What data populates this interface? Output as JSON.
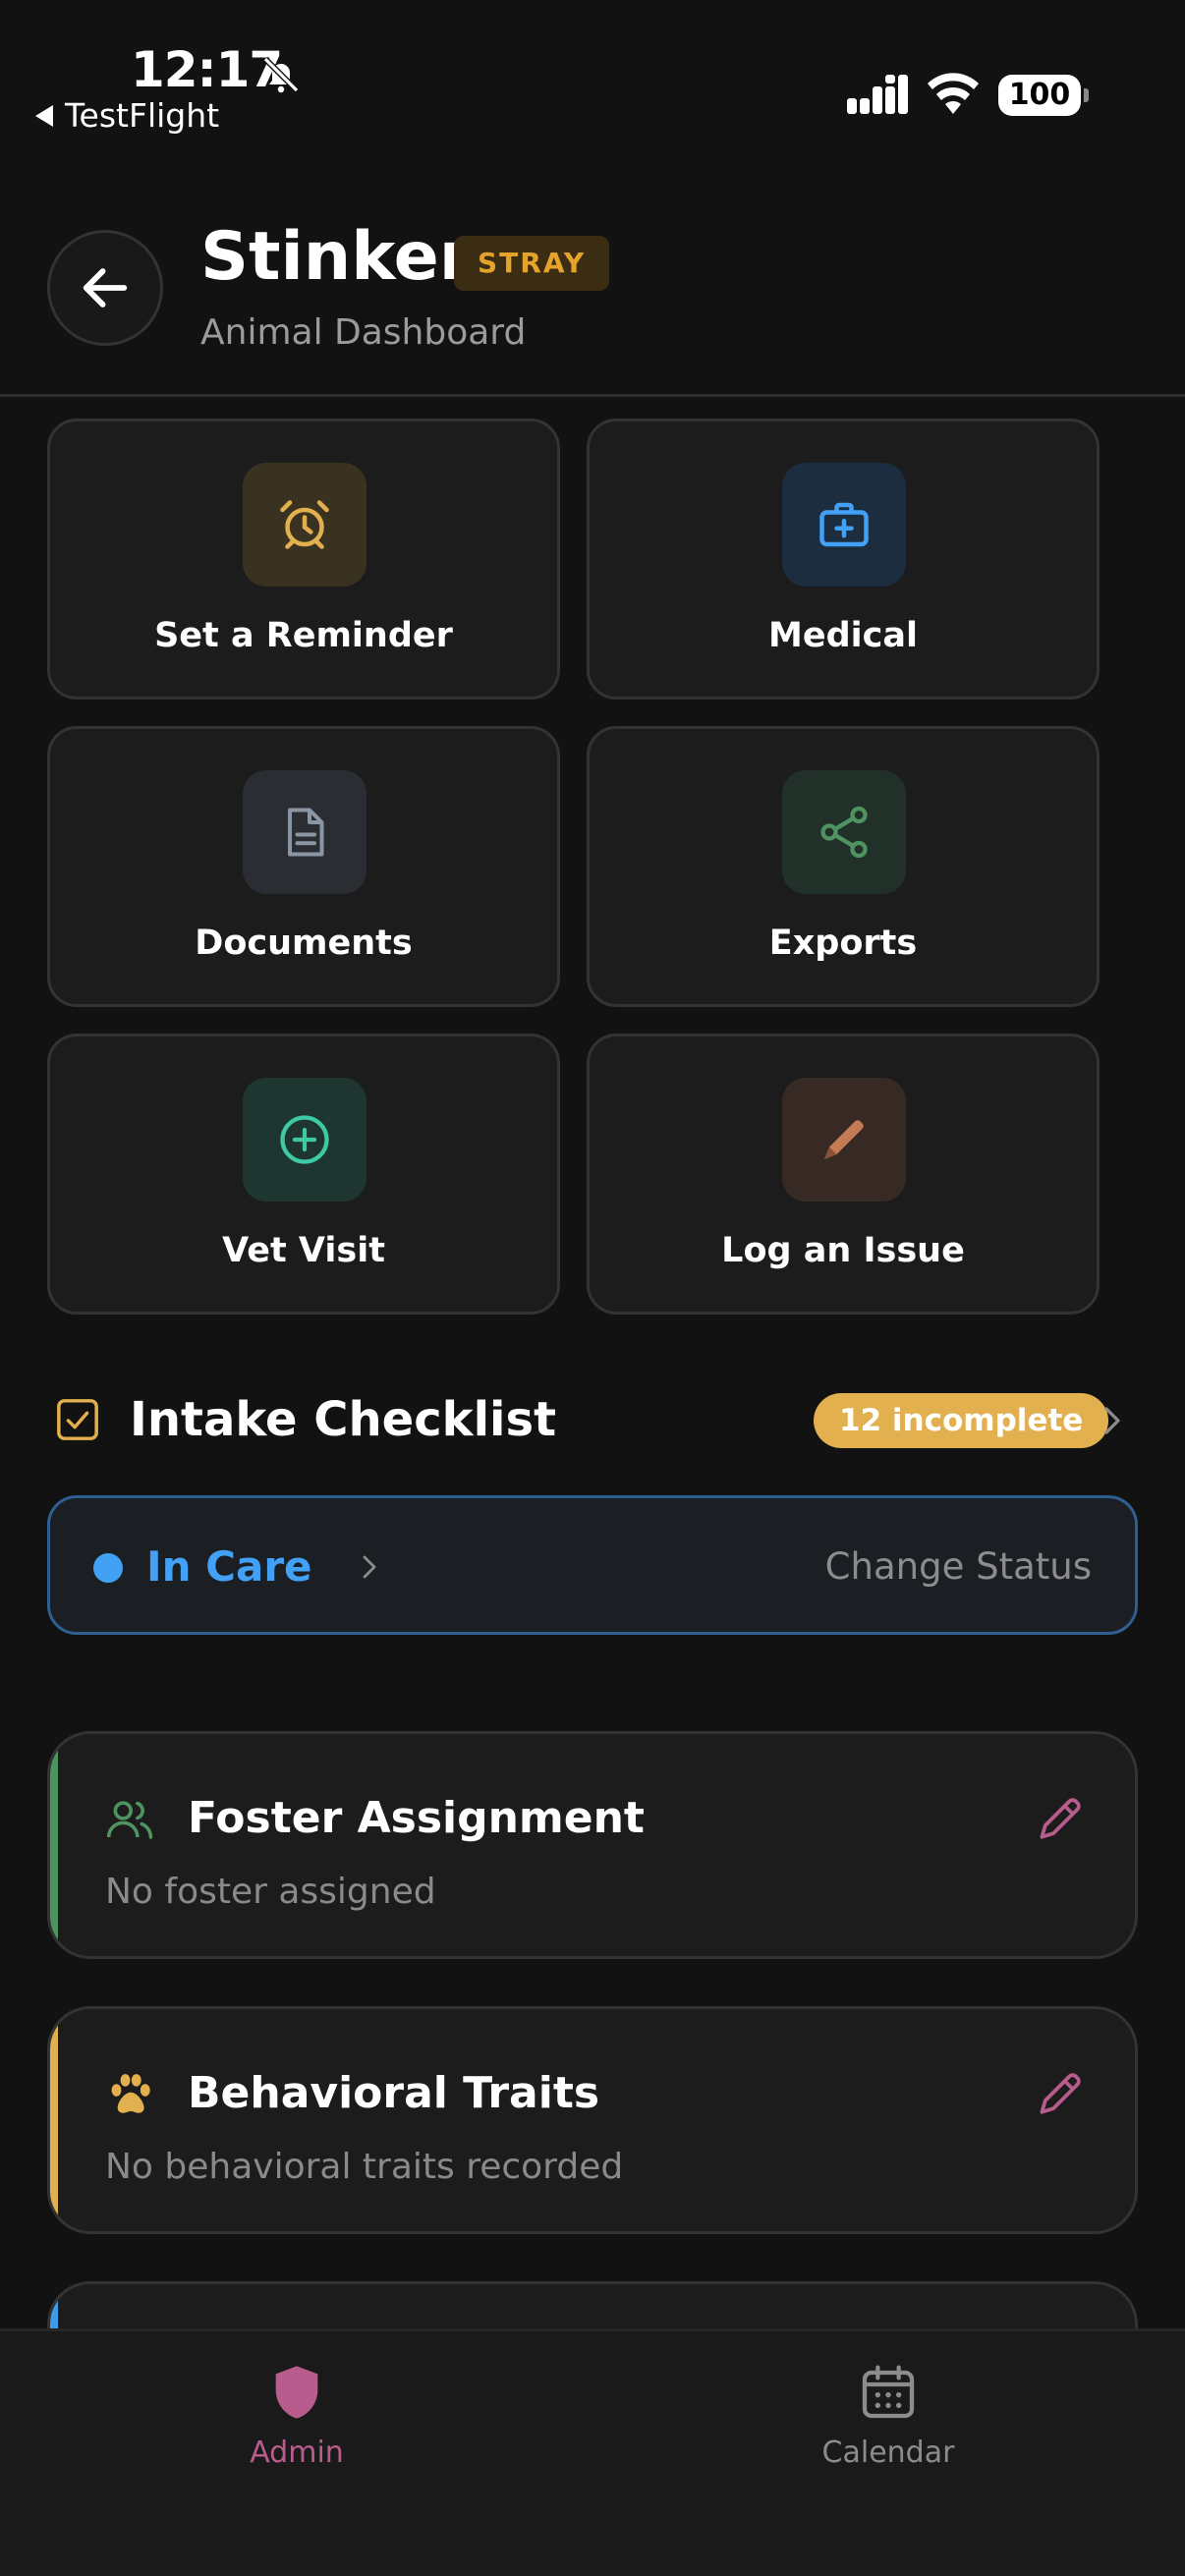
{
  "status_bar": {
    "time": "12:17",
    "back_app": "TestFlight",
    "battery": "100"
  },
  "header": {
    "title": "Stinker",
    "badge": "STRAY",
    "subtitle": "Animal Dashboard"
  },
  "actions": [
    {
      "label": "Set a Reminder",
      "icon": "alarm-clock-icon",
      "color": "#e2b04f"
    },
    {
      "label": "Medical",
      "icon": "medical-kit-icon",
      "color": "#42a1f5"
    },
    {
      "label": "Documents",
      "icon": "document-icon",
      "color": "#8b96a4"
    },
    {
      "label": "Exports",
      "icon": "share-icon",
      "color": "#4f9460"
    },
    {
      "label": "Vet Visit",
      "icon": "plus-circle-icon",
      "color": "#3fc9a4"
    },
    {
      "label": "Log an Issue",
      "icon": "pencil-icon",
      "color": "#c47a52"
    }
  ],
  "checklist": {
    "title": "Intake Checklist",
    "badge": "12 incomplete"
  },
  "status": {
    "label": "In Care",
    "action": "Change Status",
    "color": "#42a1f5"
  },
  "cards": [
    {
      "title": "Foster Assignment",
      "subtitle": "No foster assigned",
      "icon": "people-icon",
      "accent": "#4f9460"
    },
    {
      "title": "Behavioral Traits",
      "subtitle": "No behavioral traits recorded",
      "icon": "paw-icon",
      "accent": "#e2b04f"
    }
  ],
  "tabbar": {
    "tabs": [
      {
        "label": "Admin",
        "icon": "shield-icon",
        "active": true
      },
      {
        "label": "Calendar",
        "icon": "calendar-icon",
        "active": false
      }
    ],
    "active_color": "#b85c8e"
  }
}
